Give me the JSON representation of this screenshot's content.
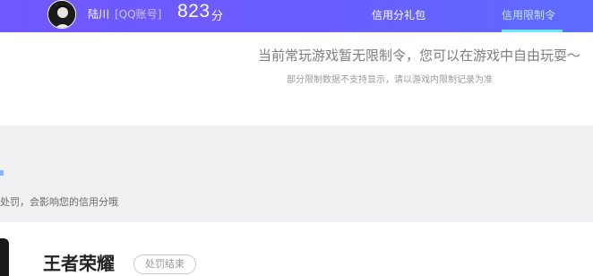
{
  "header": {
    "username": "陆川",
    "account_label": "[QQ账号]",
    "credit_score": "823",
    "score_unit": "分",
    "nav": {
      "gift_pack": "信用分礼包",
      "restriction": "信用限制令"
    },
    "colors": {
      "bar": "#6b5cff",
      "active_tab_underline": "#6ee7ff"
    }
  },
  "notice": {
    "main": "当前常玩游戏暂无限制令，您可以在游戏中自由玩耍～",
    "sub": "部分限制数据不支持显示，请以游戏内限制记录为准"
  },
  "panel": {
    "text": "处罚，会影响您的信用分哦"
  },
  "game": {
    "title": "王者荣耀",
    "status": "处罚结束"
  },
  "icons": {
    "avatar": "user-avatar"
  }
}
